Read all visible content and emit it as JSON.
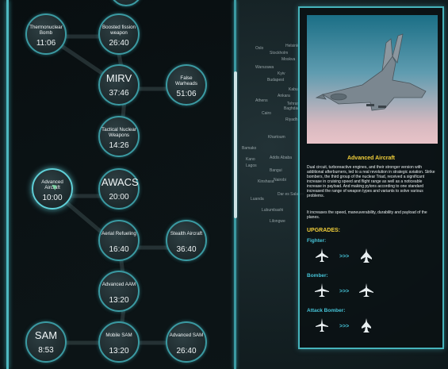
{
  "map_labels": [
    "Oslo",
    "Helsinki",
    "Stockholm",
    "Warszawa",
    "Kyiv",
    "Budapest",
    "Athens",
    "Moskva",
    "Ankara",
    "Baghdad",
    "Riyadh",
    "Tehran",
    "Kabul",
    "Cairo",
    "Khartoum",
    "Addis Ababa",
    "Kano",
    "Lagos",
    "Kinshasa",
    "Nairobi",
    "Dar es Salaam",
    "Luanda",
    "Lubumbashi",
    "Bangui",
    "Lilongwe",
    "Bamako"
  ],
  "tree": {
    "nodes": [
      {
        "id": "thermonuclear",
        "label": "Thermonuclear Bomb",
        "time": "11:06",
        "big": false
      },
      {
        "id": "boosted",
        "label": "Boosted fission weapon",
        "time": "26:40",
        "big": false
      },
      {
        "id": "mirv",
        "label": "MIRV",
        "time": "37:46",
        "big": true
      },
      {
        "id": "false-warheads",
        "label": "False Warheads",
        "time": "51:06",
        "big": false
      },
      {
        "id": "tactical",
        "label": "Tactical Nuclear Weapons",
        "time": "14:26",
        "big": false
      },
      {
        "id": "advanced-aircraft",
        "label": "Advanced Aircraft",
        "time": "10:00",
        "big": false
      },
      {
        "id": "awacs",
        "label": "AWACS",
        "time": "20:00",
        "big": true
      },
      {
        "id": "aerial-refueling",
        "label": "Aerial Refueling",
        "time": "16:40",
        "big": false
      },
      {
        "id": "stealth-aircraft",
        "label": "Stealth Aircraft",
        "time": "36:40",
        "big": false
      },
      {
        "id": "advanced-aam",
        "label": "Advanced AAM",
        "time": "13:20",
        "big": false
      },
      {
        "id": "sam",
        "label": "SAM",
        "time": "8:53",
        "big": true
      },
      {
        "id": "mobile-sam",
        "label": "Mobile SAM",
        "time": "13:20",
        "big": false
      },
      {
        "id": "advanced-sam",
        "label": "Advanced SAM",
        "time": "26:40",
        "big": false
      }
    ]
  },
  "info": {
    "title": "Advanced Aircraft",
    "description": "Dual circuit, turboreactive engines, and their stronger version with additional afterburners, led to a real revolution in strategic aviation. Strike bombers, the third group of the nuclear Triad, received a significant increase in cruising speed and flight range as well as a noticeable increase in payload. And making pylons according to one standard increased the range of weapon types and variants to solve various problems.",
    "effect": "It increases the speed, maneuverability, durability and payload of the planes.",
    "upgrades_heading": "UPGRADES:",
    "upgrades": [
      {
        "role": "Fighter:",
        "arrows": ">>>"
      },
      {
        "role": "Bomber:",
        "arrows": ">>>"
      },
      {
        "role": "Attack Bomber:",
        "arrows": ">>>"
      }
    ]
  },
  "colors": {
    "accent": "#46b3bb",
    "title": "#f2cf3a",
    "role": "#46c4d8"
  }
}
